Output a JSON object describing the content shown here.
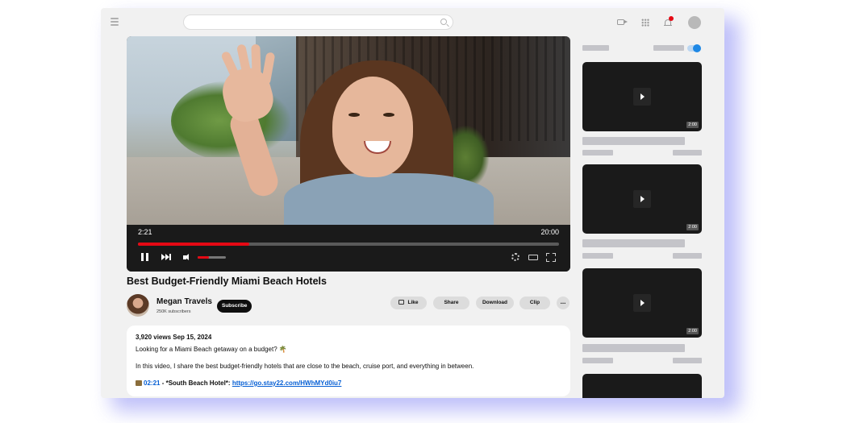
{
  "player": {
    "current_time": "2:21",
    "total_time": "20:00",
    "progress_fraction": 0.264,
    "volume_fraction": 0.4
  },
  "video": {
    "title": "Best Budget-Friendly Miami Beach Hotels",
    "channel_name": "Megan Travels",
    "subscribers": "250K subscribers",
    "subscribe_label": "Subscribe",
    "actions": {
      "like": "Like",
      "share": "Share",
      "download": "Download",
      "clip": "Clip",
      "more": "..."
    }
  },
  "description": {
    "stats": "3,920 views  Sep 15, 2024",
    "line1": "Looking for a Miami Beach getaway on a budget? 🌴",
    "line2": "In this video, I share the best budget-friendly hotels that are close to the beach, cruise port, and everything in between.",
    "chapter_time": "02:21",
    "chapter_text": " - *South Beach Hotel*: ",
    "chapter_link": "https://go.stay22.com/HWhMYd0iu7"
  },
  "sidebar": {
    "cards": [
      {
        "duration": "2:00"
      },
      {
        "duration": "2:00"
      },
      {
        "duration": "2:00"
      }
    ]
  },
  "colors": {
    "accent": "#e50914",
    "link": "#065fd4",
    "toggle": "#1e88e5"
  }
}
